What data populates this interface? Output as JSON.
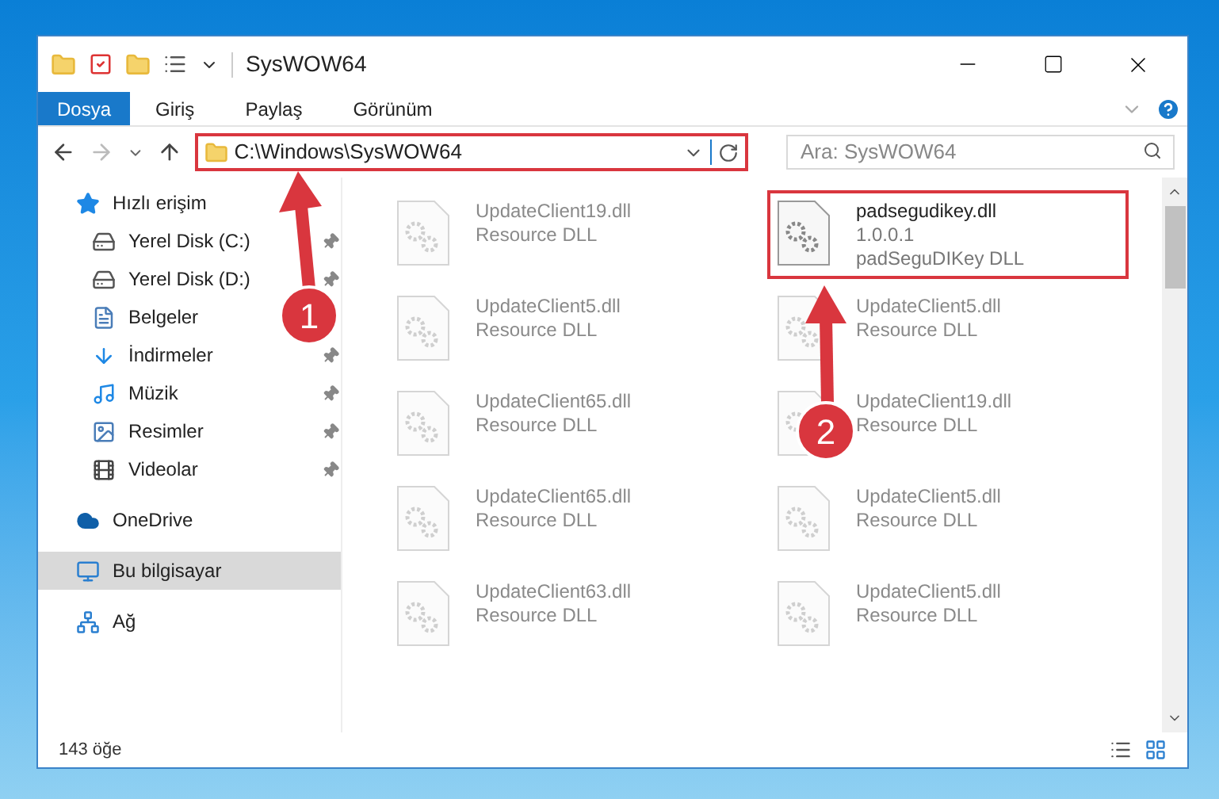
{
  "window": {
    "title": "SysWOW64"
  },
  "ribbon_tabs": [
    {
      "label": "Dosya",
      "selected": true
    },
    {
      "label": "Giriş",
      "selected": false
    },
    {
      "label": "Paylaş",
      "selected": false
    },
    {
      "label": "Görünüm",
      "selected": false
    }
  ],
  "address_bar": {
    "path": "C:\\Windows\\SysWOW64",
    "highlighted": true
  },
  "search": {
    "placeholder": "Ara: SysWOW64"
  },
  "sidebar": {
    "items": [
      {
        "label": "Hızlı erişim",
        "selected": false,
        "children": [
          {
            "label": "Yerel Disk (C:)",
            "pinned": true
          },
          {
            "label": "Yerel Disk (D:)",
            "pinned": true
          },
          {
            "label": "Belgeler",
            "pinned": false
          },
          {
            "label": "İndirmeler",
            "pinned": true
          },
          {
            "label": "Müzik",
            "pinned": true
          },
          {
            "label": "Resimler",
            "pinned": true
          },
          {
            "label": "Videolar",
            "pinned": true
          }
        ]
      },
      {
        "label": "OneDrive",
        "selected": false
      },
      {
        "label": "Bu bilgisayar",
        "selected": true
      },
      {
        "label": "Ağ",
        "selected": false
      }
    ]
  },
  "files": [
    {
      "lines": [
        "UpdateClient19.dll",
        "Resource DLL"
      ],
      "dimmed": true,
      "highlighted": false
    },
    {
      "lines": [
        "padsegudikey.dll",
        "1.0.0.1",
        "padSeguDIKey DLL"
      ],
      "dimmed": false,
      "highlighted": true
    },
    {
      "lines": [
        "UpdateClient5.dll",
        "Resource DLL"
      ],
      "dimmed": true,
      "highlighted": false
    },
    {
      "lines": [
        "UpdateClient5.dll",
        "Resource DLL"
      ],
      "dimmed": true,
      "highlighted": false
    },
    {
      "lines": [
        "UpdateClient65.dll",
        "Resource DLL"
      ],
      "dimmed": true,
      "highlighted": false
    },
    {
      "lines": [
        "UpdateClient19.dll",
        "Resource DLL"
      ],
      "dimmed": true,
      "highlighted": false
    },
    {
      "lines": [
        "UpdateClient65.dll",
        "Resource DLL"
      ],
      "dimmed": true,
      "highlighted": false
    },
    {
      "lines": [
        "UpdateClient5.dll",
        "Resource DLL"
      ],
      "dimmed": true,
      "highlighted": false
    },
    {
      "lines": [
        "UpdateClient63.dll",
        "Resource DLL"
      ],
      "dimmed": true,
      "highlighted": false
    },
    {
      "lines": [
        "UpdateClient5.dll",
        "Resource DLL"
      ],
      "dimmed": true,
      "highlighted": false
    }
  ],
  "status_bar": {
    "count": "143 öğe"
  },
  "annotations": [
    {
      "number": "1"
    },
    {
      "number": "2"
    }
  ]
}
